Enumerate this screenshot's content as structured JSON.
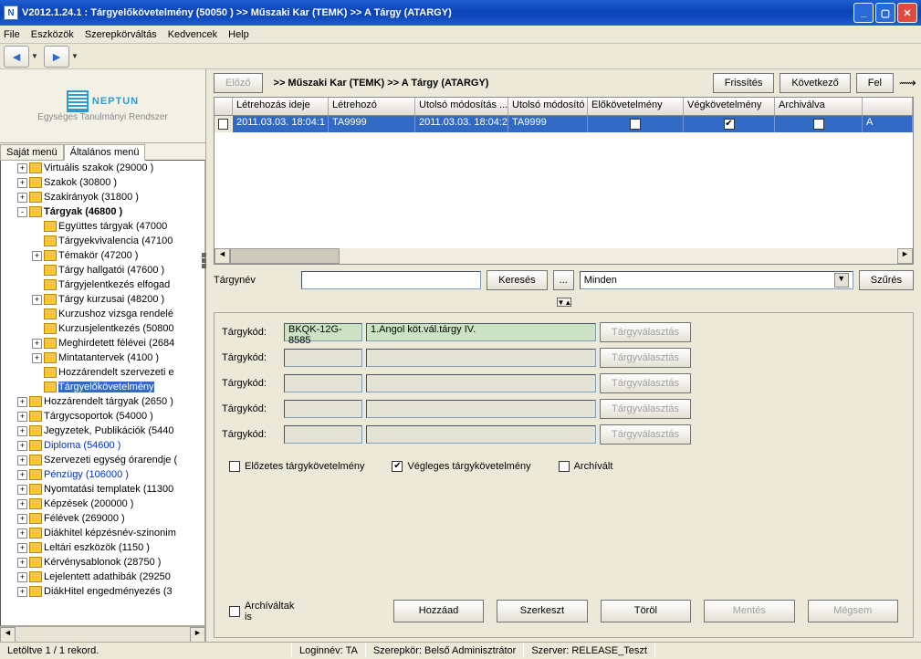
{
  "window_title": "V2012.1.24.1 : Tárgyelőkövetelmény (50050  )   >> Műszaki Kar (TEMK) >> A Tárgy (ATARGY)",
  "menu": [
    "File",
    "Eszközök",
    "Szerepkörváltás",
    "Kedvencek",
    "Help"
  ],
  "logo": {
    "text": "NEPTUN",
    "subtitle": "Egységes Tanulmányi Rendszer"
  },
  "left_tabs": [
    "Saját menü",
    "Általános menü"
  ],
  "tree": [
    {
      "lvl": 1,
      "exp": "+",
      "label": "Virtuális szakok (29000  )"
    },
    {
      "lvl": 1,
      "exp": "+",
      "label": "Szakok (30800  )"
    },
    {
      "lvl": 1,
      "exp": "+",
      "label": "Szakirányok (31800  )"
    },
    {
      "lvl": 1,
      "exp": "-",
      "label": "Tárgyak (46800  )",
      "bold": true
    },
    {
      "lvl": 2,
      "exp": "",
      "label": "Együttes tárgyak (47000"
    },
    {
      "lvl": 2,
      "exp": "",
      "label": "Tárgyekvivalencia (47100"
    },
    {
      "lvl": 2,
      "exp": "+",
      "label": "Témakör (47200  )"
    },
    {
      "lvl": 2,
      "exp": "",
      "label": "Tárgy hallgatói (47600  )"
    },
    {
      "lvl": 2,
      "exp": "",
      "label": "Tárgyjelentkezés elfogad"
    },
    {
      "lvl": 2,
      "exp": "+",
      "label": "Tárgy kurzusai (48200  )"
    },
    {
      "lvl": 2,
      "exp": "",
      "label": "Kurzushoz vizsga rendelé"
    },
    {
      "lvl": 2,
      "exp": "",
      "label": "Kurzusjelentkezés (50800"
    },
    {
      "lvl": 2,
      "exp": "+",
      "label": "Meghirdetett félévei (2684"
    },
    {
      "lvl": 2,
      "exp": "+",
      "label": "Mintatantervek (4100  )"
    },
    {
      "lvl": 2,
      "exp": "",
      "label": "Hozzárendelt szervezeti e"
    },
    {
      "lvl": 2,
      "exp": "",
      "label": "Tárgyelőkövetelmény",
      "selected": true
    },
    {
      "lvl": 1,
      "exp": "+",
      "label": "Hozzárendelt tárgyak (2650  )"
    },
    {
      "lvl": 1,
      "exp": "+",
      "label": "Tárgycsoportok (54000  )"
    },
    {
      "lvl": 1,
      "exp": "+",
      "label": "Jegyzetek, Publikációk (5440"
    },
    {
      "lvl": 1,
      "exp": "+",
      "label": "Diploma (54600  )",
      "link": true
    },
    {
      "lvl": 1,
      "exp": "+",
      "label": "Szervezeti egység órarendje ("
    },
    {
      "lvl": 1,
      "exp": "+",
      "label": "Pénzügy (106000  )",
      "link": true
    },
    {
      "lvl": 1,
      "exp": "+",
      "label": "Nyomtatási templatek (11300"
    },
    {
      "lvl": 1,
      "exp": "+",
      "label": "Képzések (200000  )"
    },
    {
      "lvl": 1,
      "exp": "+",
      "label": "Félévek (269000  )"
    },
    {
      "lvl": 1,
      "exp": "+",
      "label": "Diákhitel képzésnév-szinonim"
    },
    {
      "lvl": 1,
      "exp": "+",
      "label": "Leltári eszközök (1150  )"
    },
    {
      "lvl": 1,
      "exp": "+",
      "label": "Kérvénysablonok (28750  )"
    },
    {
      "lvl": 1,
      "exp": "+",
      "label": "Lejelentett adathibák (29250"
    },
    {
      "lvl": 1,
      "exp": "+",
      "label": "DiákHitel engedményezés (3"
    }
  ],
  "top_buttons": {
    "prev": "Előző",
    "refresh": "Frissítés",
    "next": "Következő",
    "up": "Fel"
  },
  "breadcrumb": ">> Műszaki Kar (TEMK) >> A Tárgy (ATARGY)",
  "grid": {
    "headers": [
      "",
      "Létrehozás ideje",
      "Létrehozó",
      "Utolsó módosítás ...",
      "Utolsó módosító",
      "Előkövetelmény",
      "Végkövetelmény",
      "Archiválva",
      ""
    ],
    "row": {
      "c1": "2011.03.03. 18:04:1",
      "c2": "TA9999",
      "c3": "2011.03.03. 18:04:2",
      "c4": "TA9999",
      "pre": false,
      "end": true,
      "arc": false,
      "last": "A"
    }
  },
  "search": {
    "label": "Tárgynév",
    "btn": "Keresés",
    "more": "...",
    "combo": "Minden",
    "filter": "Szűrés"
  },
  "form": {
    "label": "Tárgykód:",
    "rows": [
      {
        "code": "BKQK-12G-8585",
        "name": "1.Angol köt.vál.tárgy IV.",
        "btn": "Tárgyválasztás"
      },
      {
        "code": "",
        "name": "",
        "btn": "Tárgyválasztás"
      },
      {
        "code": "",
        "name": "",
        "btn": "Tárgyválasztás"
      },
      {
        "code": "",
        "name": "",
        "btn": "Tárgyválasztás"
      },
      {
        "code": "",
        "name": "",
        "btn": "Tárgyválasztás"
      }
    ],
    "checks": {
      "pre": "Előzetes tárgykövetelmény",
      "final": "Végleges tárgykövetelmény",
      "arc": "Archívált",
      "final_checked": true
    },
    "archive_also": "Archíváltak is",
    "actions": {
      "add": "Hozzáad",
      "edit": "Szerkeszt",
      "del": "Töröl",
      "save": "Mentés",
      "cancel": "Mégsem"
    }
  },
  "status": {
    "records": "Letöltve 1 / 1 rekord.",
    "login": "Loginnév: TA",
    "role": "Szerepkör: Belső Adminisztrátor",
    "server": "Szerver: RELEASE_Teszt"
  }
}
